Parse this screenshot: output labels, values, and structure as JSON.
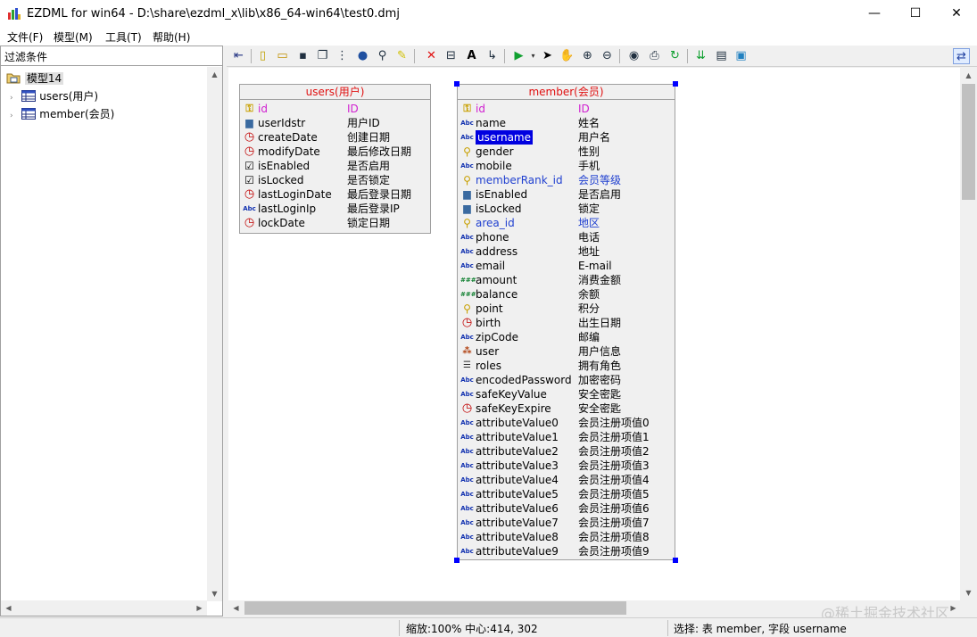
{
  "window": {
    "title": "EZDML for win64 - D:\\share\\ezdml_x\\lib\\x86_64-win64\\test0.dmj",
    "min_glyph": "—",
    "max_glyph": "☐",
    "close_glyph": "✕"
  },
  "menu": [
    "文件(F)",
    "模型(M)",
    "工具(T)",
    "帮助(H)"
  ],
  "left": {
    "filter_label": "过滤条件",
    "tree_root": "模型14",
    "tree_items": [
      "users(用户)",
      "member(会员)"
    ]
  },
  "users_table": {
    "title": "users(用户)",
    "fields": [
      {
        "name": "id",
        "label": "ID",
        "icon": "key-icon",
        "style": "pk"
      },
      {
        "name": "userIdstr",
        "label": "用户ID",
        "icon": "number-icon",
        "style": ""
      },
      {
        "name": "createDate",
        "label": "创建日期",
        "icon": "clock-icon",
        "style": ""
      },
      {
        "name": "modifyDate",
        "label": "最后修改日期",
        "icon": "clock-icon",
        "style": ""
      },
      {
        "name": "isEnabled",
        "label": "是否启用",
        "icon": "checkbox-icon",
        "style": ""
      },
      {
        "name": "isLocked",
        "label": "是否锁定",
        "icon": "checkbox-icon",
        "style": ""
      },
      {
        "name": "lastLoginDate",
        "label": "最后登录日期",
        "icon": "clock-icon",
        "style": ""
      },
      {
        "name": "lastLoginIp",
        "label": "最后登录IP",
        "icon": "string-icon",
        "style": ""
      },
      {
        "name": "lockDate",
        "label": "锁定日期",
        "icon": "clock-icon",
        "style": ""
      }
    ]
  },
  "member_table": {
    "title": "member(会员)",
    "fields": [
      {
        "name": "id",
        "label": "ID",
        "icon": "key-icon",
        "style": "pk"
      },
      {
        "name": "name",
        "label": "姓名",
        "icon": "string-icon",
        "style": ""
      },
      {
        "name": "username",
        "label": "用户名",
        "icon": "string-icon",
        "style": "sel"
      },
      {
        "name": "gender",
        "label": "性别",
        "icon": "enum-icon",
        "style": ""
      },
      {
        "name": "mobile",
        "label": "手机",
        "icon": "string-icon",
        "style": ""
      },
      {
        "name": "memberRank_id",
        "label": "会员等级",
        "icon": "enum-icon",
        "style": "fk"
      },
      {
        "name": "isEnabled",
        "label": "是否启用",
        "icon": "number-icon",
        "style": ""
      },
      {
        "name": "isLocked",
        "label": "锁定",
        "icon": "number-icon",
        "style": ""
      },
      {
        "name": "area_id",
        "label": "地区",
        "icon": "enum-icon",
        "style": "fk"
      },
      {
        "name": "phone",
        "label": "电话",
        "icon": "string-icon",
        "style": ""
      },
      {
        "name": "address",
        "label": "地址",
        "icon": "string-icon",
        "style": ""
      },
      {
        "name": "email",
        "label": "E-mail",
        "icon": "string-icon",
        "style": ""
      },
      {
        "name": "amount",
        "label": "消费金额",
        "icon": "decimal-icon",
        "style": ""
      },
      {
        "name": "balance",
        "label": "余额",
        "icon": "decimal-icon",
        "style": ""
      },
      {
        "name": "point",
        "label": "积分",
        "icon": "enum-icon",
        "style": ""
      },
      {
        "name": "birth",
        "label": "出生日期",
        "icon": "clock-icon",
        "style": ""
      },
      {
        "name": "zipCode",
        "label": "邮编",
        "icon": "string-icon",
        "style": ""
      },
      {
        "name": "user",
        "label": "用户信息",
        "icon": "object-icon",
        "style": ""
      },
      {
        "name": "roles",
        "label": "拥有角色",
        "icon": "list-icon",
        "style": ""
      },
      {
        "name": "encodedPassword",
        "label": "加密密码",
        "icon": "string-icon",
        "style": ""
      },
      {
        "name": "safeKeyValue",
        "label": "安全密匙",
        "icon": "string-icon",
        "style": ""
      },
      {
        "name": "safeKeyExpire",
        "label": "安全密匙",
        "icon": "clock-icon",
        "style": ""
      },
      {
        "name": "attributeValue0",
        "label": "会员注册项值0",
        "icon": "string-icon",
        "style": ""
      },
      {
        "name": "attributeValue1",
        "label": "会员注册项值1",
        "icon": "string-icon",
        "style": ""
      },
      {
        "name": "attributeValue2",
        "label": "会员注册项值2",
        "icon": "string-icon",
        "style": ""
      },
      {
        "name": "attributeValue3",
        "label": "会员注册项值3",
        "icon": "string-icon",
        "style": ""
      },
      {
        "name": "attributeValue4",
        "label": "会员注册项值4",
        "icon": "string-icon",
        "style": ""
      },
      {
        "name": "attributeValue5",
        "label": "会员注册项值5",
        "icon": "string-icon",
        "style": ""
      },
      {
        "name": "attributeValue6",
        "label": "会员注册项值6",
        "icon": "string-icon",
        "style": ""
      },
      {
        "name": "attributeValue7",
        "label": "会员注册项值7",
        "icon": "string-icon",
        "style": ""
      },
      {
        "name": "attributeValue8",
        "label": "会员注册项值8",
        "icon": "string-icon",
        "style": ""
      },
      {
        "name": "attributeValue9",
        "label": "会员注册项值9",
        "icon": "string-icon",
        "style": ""
      }
    ]
  },
  "status": {
    "zoom": "缩放:100% 中心:414, 302",
    "selection": "选择: 表 member, 字段 username"
  },
  "watermark": "@稀土掘金技术社区",
  "colors": {
    "title_red": "#e01010",
    "pk_magenta": "#d020d0",
    "fk_blue": "#2040d0",
    "selection_blue": "#0000e0"
  }
}
